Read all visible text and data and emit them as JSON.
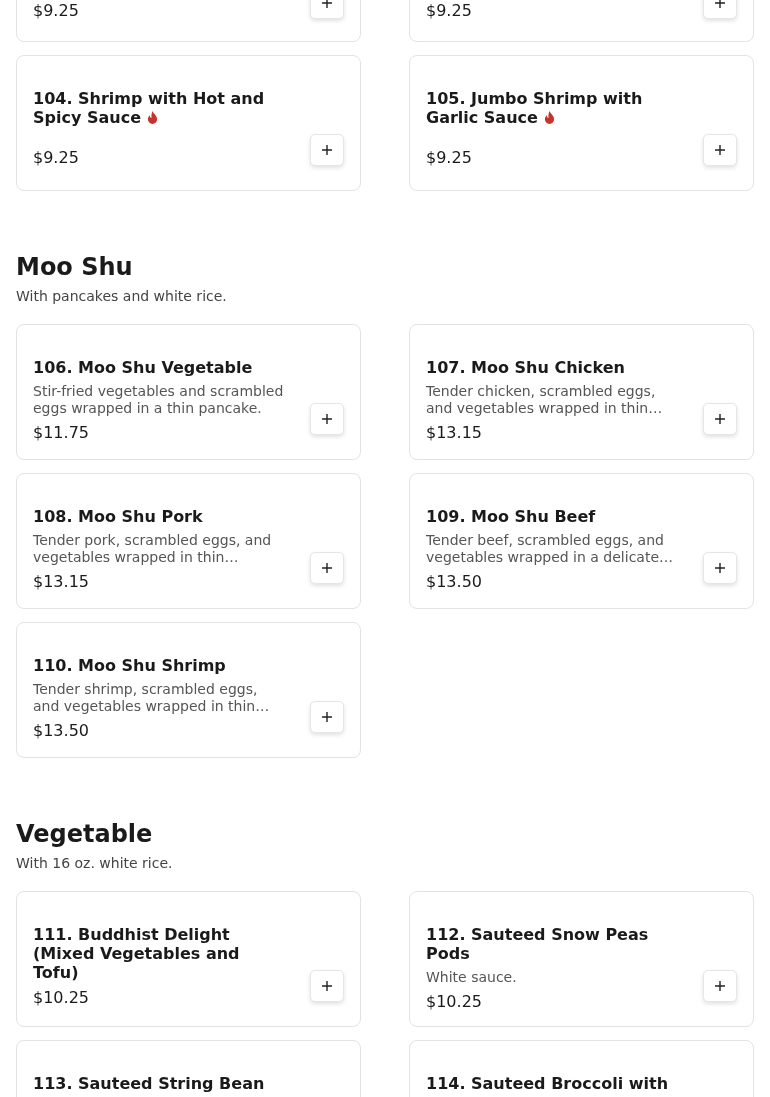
{
  "sections": [
    {
      "items": [
        {
          "kind": "cut_top",
          "price": "$9.25"
        },
        {
          "kind": "cut_top",
          "price": "$9.25"
        },
        {
          "kind": "full",
          "title": "104. Shrimp with Hot and Spicy Sauce",
          "spicy": true,
          "price": "$9.25"
        },
        {
          "kind": "full",
          "title": "105. Jumbo Shrimp with Garlic Sauce",
          "spicy": true,
          "price": "$9.25"
        }
      ]
    },
    {
      "title": "Moo Shu",
      "subtitle": "With pancakes and white rice.",
      "items": [
        {
          "kind": "full",
          "title": "106. Moo Shu Vegetable",
          "spicy": false,
          "description": "Stir-fried vegetables and scrambled eggs wrapped in a thin pancake.",
          "price": "$11.75"
        },
        {
          "kind": "full",
          "title": "107. Moo Shu Chicken",
          "spicy": false,
          "description": "Tender chicken, scrambled eggs, and vegetables wrapped in thin…",
          "price": "$13.15"
        },
        {
          "kind": "full",
          "title": "108. Moo Shu Pork",
          "spicy": false,
          "description": "Tender pork, scrambled eggs, and vegetables wrapped in thin…",
          "price": "$13.15"
        },
        {
          "kind": "full",
          "title": "109. Moo Shu Beef",
          "spicy": false,
          "description": "Tender beef, scrambled eggs, and vegetables wrapped in a delicate…",
          "price": "$13.50"
        },
        {
          "kind": "full",
          "title": "110. Moo Shu Shrimp",
          "spicy": false,
          "description": "Tender shrimp, scrambled eggs, and vegetables wrapped in thin…",
          "price": "$13.50"
        }
      ]
    },
    {
      "title": "Vegetable",
      "subtitle": "With 16 oz. white rice.",
      "items": [
        {
          "kind": "full",
          "title": "111. Buddhist Delight (Mixed Vegetables and Tofu)",
          "spicy": false,
          "price": "$10.25"
        },
        {
          "kind": "full",
          "title": "112. Sauteed Snow Peas Pods",
          "spicy": false,
          "description": "White sauce.",
          "price": "$10.25"
        },
        {
          "kind": "cut_bottom",
          "title": "113. Sauteed String Bean",
          "spicy": false
        },
        {
          "kind": "cut_bottom",
          "title": "114. Sauteed Broccoli with",
          "spicy": false
        }
      ]
    }
  ]
}
